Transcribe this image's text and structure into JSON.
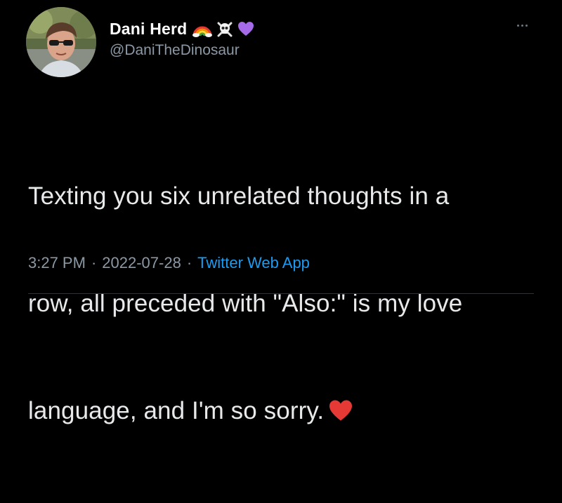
{
  "user": {
    "display_name": "Dani Herd",
    "handle": "@DaniTheDinosaur",
    "name_emojis": [
      "rainbow-icon",
      "skull-crossbones-icon",
      "purple-heart-icon"
    ]
  },
  "tweet": {
    "lines": [
      "Texting you six unrelated thoughts in a",
      "row, all preceded with \"Also:\" is my love",
      "language, and I'm so sorry."
    ],
    "trailing_emoji": "red-heart-icon"
  },
  "meta": {
    "time": "3:27 PM",
    "separator": "·",
    "date": "2022-07-28",
    "source": "Twitter Web App"
  },
  "colors": {
    "background": "#000000",
    "text": "#e7e9ea",
    "secondary": "#8b98a5",
    "link": "#1d9bf0"
  }
}
